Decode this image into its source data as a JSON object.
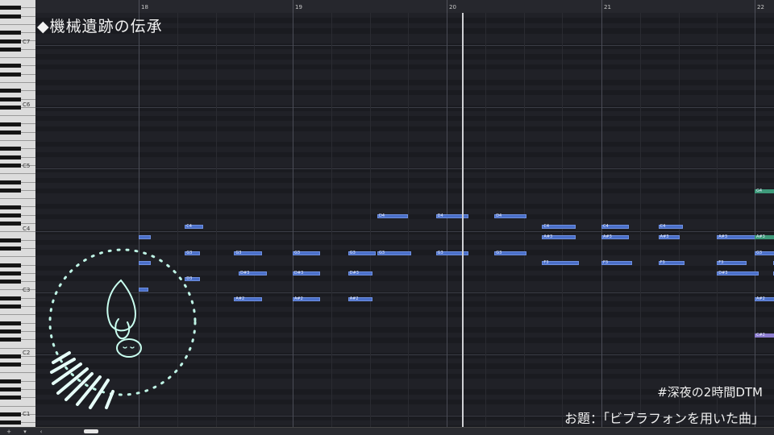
{
  "title": "◆機械遺跡の伝承",
  "overlay": {
    "hashtag": "#深夜の2時間DTM",
    "theme": "お題：「ビブラフォンを用いた曲」"
  },
  "ruler": {
    "bars": [
      {
        "num": "18"
      },
      {
        "num": "19"
      },
      {
        "num": "20"
      },
      {
        "num": "21"
      },
      {
        "num": "22"
      }
    ]
  },
  "keyboard": {
    "octaves": [
      "C7",
      "C6",
      "C5",
      "C4",
      "C3",
      "C2",
      "C1"
    ]
  },
  "notes": [
    {
      "label": "C4",
      "bar": 0.3,
      "len": 0.12,
      "pitch": "C4"
    },
    {
      "label": "",
      "bar": 0.0,
      "len": 0.08,
      "pitch": "A#3"
    },
    {
      "label": "G3",
      "bar": 0.3,
      "len": 0.1,
      "pitch": "G3"
    },
    {
      "label": "",
      "bar": 0.0,
      "len": 0.08,
      "pitch": "F3"
    },
    {
      "label": "D3",
      "bar": 0.3,
      "len": 0.1,
      "pitch": "D#3"
    },
    {
      "label": "",
      "bar": 0.0,
      "len": 0.06,
      "pitch": "C#3"
    },
    {
      "label": "G3",
      "bar": 0.62,
      "len": 0.18,
      "pitch": "G3"
    },
    {
      "label": "D#3",
      "bar": 0.65,
      "len": 0.18,
      "pitch": "D#3b"
    },
    {
      "label": "A#2",
      "bar": 0.62,
      "len": 0.18,
      "pitch": "A#2"
    },
    {
      "label": "G3",
      "bar": 1.0,
      "len": 0.18,
      "pitch": "G3"
    },
    {
      "label": "D#3",
      "bar": 1.0,
      "len": 0.18,
      "pitch": "D#3b"
    },
    {
      "label": "A#2",
      "bar": 1.0,
      "len": 0.18,
      "pitch": "A#2"
    },
    {
      "label": "G3",
      "bar": 1.36,
      "len": 0.18,
      "pitch": "G3"
    },
    {
      "label": "D#3",
      "bar": 1.36,
      "len": 0.16,
      "pitch": "D#3b"
    },
    {
      "label": "A#2",
      "bar": 1.36,
      "len": 0.16,
      "pitch": "A#2"
    },
    {
      "label": "D4",
      "bar": 1.55,
      "len": 0.2,
      "pitch": "D4"
    },
    {
      "label": "G3",
      "bar": 1.55,
      "len": 0.22,
      "pitch": "G3"
    },
    {
      "label": "D4",
      "bar": 1.93,
      "len": 0.21,
      "pitch": "D4"
    },
    {
      "label": "G3",
      "bar": 1.93,
      "len": 0.21,
      "pitch": "G3"
    },
    {
      "label": "D4",
      "bar": 2.31,
      "len": 0.21,
      "pitch": "D4"
    },
    {
      "label": "G3",
      "bar": 2.31,
      "len": 0.21,
      "pitch": "G3"
    },
    {
      "label": "C4",
      "bar": 2.62,
      "len": 0.22,
      "pitch": "C4"
    },
    {
      "label": "A#3",
      "bar": 2.62,
      "len": 0.22,
      "pitch": "A#3"
    },
    {
      "label": "F3",
      "bar": 2.62,
      "len": 0.24,
      "pitch": "F3"
    },
    {
      "label": "C4",
      "bar": 3.0,
      "len": 0.18,
      "pitch": "C4"
    },
    {
      "label": "A#3",
      "bar": 3.0,
      "len": 0.18,
      "pitch": "A#3"
    },
    {
      "label": "F3",
      "bar": 3.0,
      "len": 0.2,
      "pitch": "F3"
    },
    {
      "label": "C4",
      "bar": 3.37,
      "len": 0.16,
      "pitch": "C4"
    },
    {
      "label": "A#3",
      "bar": 3.37,
      "len": 0.14,
      "pitch": "A#3"
    },
    {
      "label": "F3",
      "bar": 3.37,
      "len": 0.17,
      "pitch": "F3"
    },
    {
      "label": "A#3",
      "bar": 3.75,
      "len": 0.27,
      "pitch": "A#3"
    },
    {
      "label": "F3",
      "bar": 3.75,
      "len": 0.19,
      "pitch": "F3"
    },
    {
      "label": "D#3",
      "bar": 3.75,
      "len": 0.27,
      "pitch": "D#3b"
    },
    {
      "label": "A#3",
      "bar": 4.12,
      "len": 0.15,
      "pitch": "A#3"
    },
    {
      "label": "F3",
      "bar": 4.12,
      "len": 0.14,
      "pitch": "F3"
    },
    {
      "label": "D#3",
      "bar": 4.12,
      "len": 0.14,
      "pitch": "D#3b"
    },
    {
      "label": "C4",
      "bar": 4.5,
      "len": 0.15,
      "pitch": "C4"
    },
    {
      "label": "G3",
      "bar": 4.5,
      "len": 0.15,
      "pitch": "G3"
    },
    {
      "label": "F3",
      "bar": 4.5,
      "len": 0.15,
      "pitch": "F3"
    },
    {
      "label": "G4",
      "bar": 5.0,
      "len": 0.2,
      "pitch": "G4",
      "color": "#3e9a7a"
    },
    {
      "label": "A#3",
      "bar": 5.0,
      "len": 0.2,
      "pitch": "A#3",
      "color": "#3e9a7a"
    },
    {
      "label": "G3",
      "bar": 5.0,
      "len": 0.2,
      "pitch": "G3"
    },
    {
      "label": "A#2",
      "bar": 5.0,
      "len": 0.2,
      "pitch": "A#2"
    },
    {
      "label": "C#2",
      "bar": 5.0,
      "len": 0.2,
      "pitch": "C#2",
      "color": "#8c7ccf"
    }
  ],
  "colors": {
    "note": "#4a6fc9",
    "background": "#1f2025",
    "accent_glow": "#bff5e6"
  }
}
